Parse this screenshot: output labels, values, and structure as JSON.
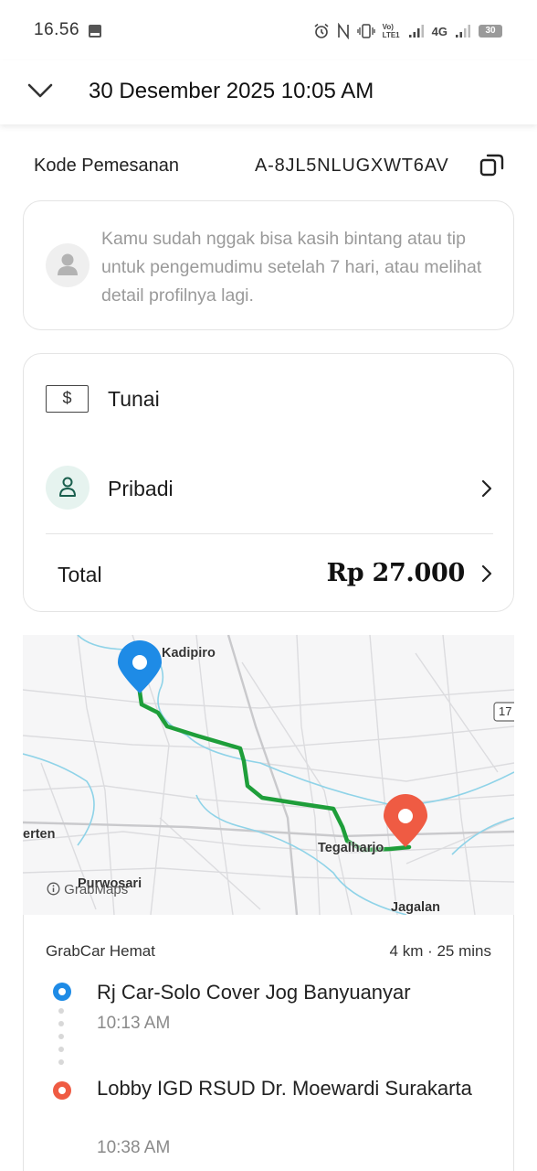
{
  "status_bar": {
    "time": "16.56",
    "icons": [
      "pdf-icon",
      "alarm-icon",
      "nfc-icon",
      "vibrate-icon",
      "volte-icon",
      "signal-icon",
      "4g-icon",
      "signal-icon",
      "battery-icon"
    ],
    "network": "4G",
    "volte": "Vo) LTE1",
    "battery": "30"
  },
  "header": {
    "title": "30 Desember 2025 10:05 AM"
  },
  "booking": {
    "label": "Kode Pemesanan",
    "code": "A-8JL5NLUGXWT6AV"
  },
  "info": {
    "message": "Kamu sudah nggak bisa kasih bintang atau tip untuk pengemudimu setelah 7 hari, atau melihat detail profilnya lagi."
  },
  "payment": {
    "method": "Tunai",
    "method_symbol": "$",
    "profile": "Pribadi",
    "total_label": "Total",
    "total_value": "Rp 27.000"
  },
  "map": {
    "labels": {
      "kadipiro": "Kadipiro",
      "road_number": "17",
      "kerten": "erten",
      "tegalharjo": "Tegalharjo",
      "purwosari": "Purwosari",
      "jagalan": "Jagalan"
    },
    "credit": "GrabMaps",
    "colors": {
      "route": "#1e9e3a",
      "pickup_pin": "#1e8be6",
      "dropoff_pin": "#ef5b43",
      "water": "#8fd3e8"
    }
  },
  "trip": {
    "service": "GrabCar Hemat",
    "distance_duration": "4 km · 25 mins",
    "pickup": {
      "name": "Rj Car-Solo Cover Jog Banyuanyar",
      "time": "10:13 AM",
      "color": "#1e8be6"
    },
    "dropoff": {
      "name": "Lobby IGD RSUD Dr. Moewardi Surakarta",
      "time": "10:38 AM",
      "color": "#ef5b43"
    }
  }
}
